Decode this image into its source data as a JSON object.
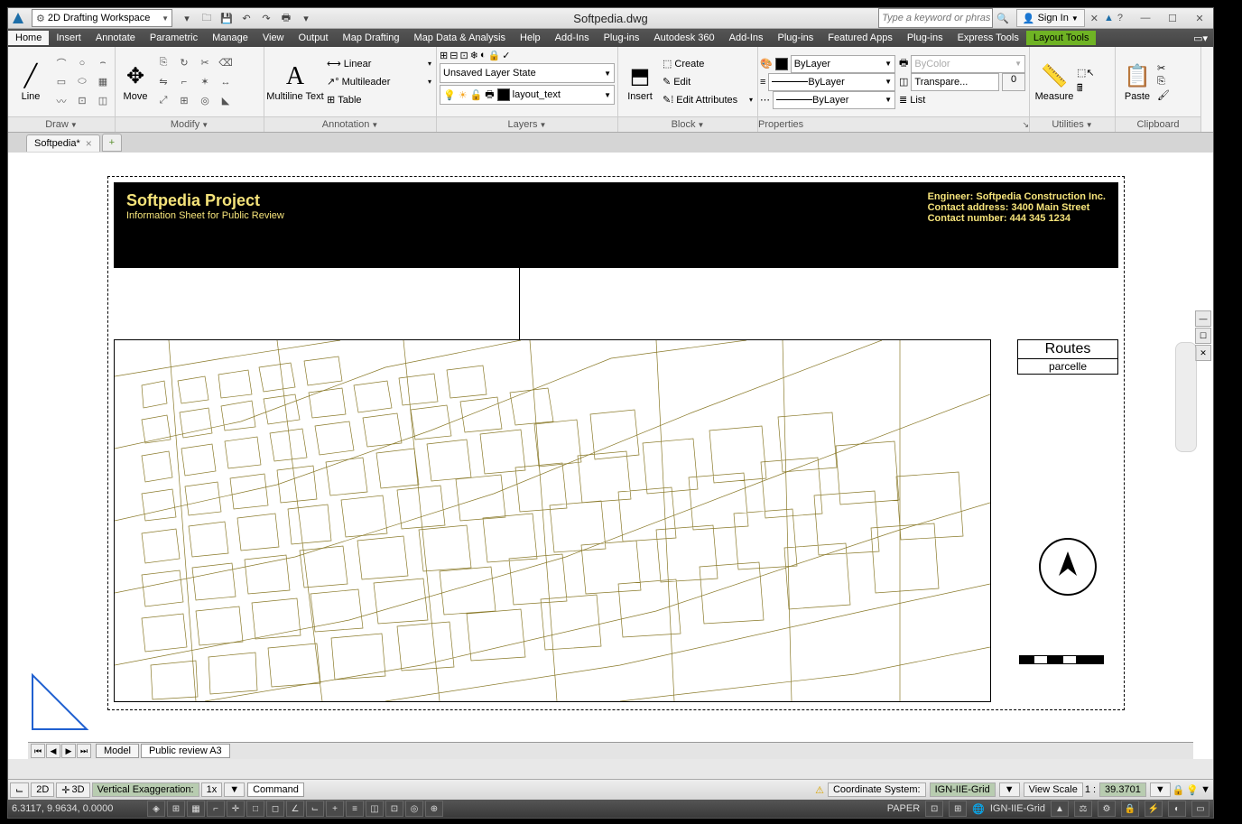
{
  "title": "Softpedia.dwg",
  "workspace": "2D Drafting Workspace",
  "search_placeholder": "Type a keyword or phrase",
  "signin": "Sign In",
  "menubar": [
    "Home",
    "Insert",
    "Annotate",
    "Parametric",
    "Manage",
    "View",
    "Output",
    "Map Drafting",
    "Map Data & Analysis",
    "Help",
    "Add-Ins",
    "Plug-ins",
    "Autodesk 360",
    "Add-Ins",
    "Plug-ins",
    "Featured Apps",
    "Plug-ins",
    "Express Tools",
    "Layout Tools"
  ],
  "ribbon": {
    "draw": {
      "line": "Line",
      "title": "Draw"
    },
    "modify": {
      "move": "Move",
      "title": "Modify"
    },
    "annotation": {
      "mtext": "Multiline Text",
      "linear": "Linear",
      "multileader": "Multileader",
      "table": "Table",
      "title": "Annotation"
    },
    "layers": {
      "state": "Unsaved Layer State",
      "current": "layout_text",
      "title": "Layers"
    },
    "block": {
      "insert": "Insert",
      "create": "Create",
      "edit": "Edit",
      "editattr": "Edit Attributes",
      "title": "Block"
    },
    "properties": {
      "bylayer": "ByLayer",
      "bylayer2": "ByLayer",
      "bylayer3": "ByLayer",
      "bycolor": "ByColor",
      "transp": "Transpare...",
      "transp_val": "0",
      "list": "List",
      "title": "Properties"
    },
    "utilities": {
      "measure": "Measure",
      "title": "Utilities"
    },
    "clipboard": {
      "paste": "Paste",
      "title": "Clipboard"
    }
  },
  "doctab": "Softpedia*",
  "sheet": {
    "title": "Softpedia Project",
    "subtitle": "Information Sheet for Public Review",
    "engineer": "Engineer: Softpedia Construction Inc.",
    "address": "Contact address: 3400 Main Street",
    "phone": "Contact number: 444 345 1234"
  },
  "legend": {
    "head": "Routes",
    "row": "parcelle"
  },
  "layout_tabs": {
    "model": "Model",
    "layout": "Public review A3"
  },
  "statusbar1": {
    "b2d": "2D",
    "b3d": "3D",
    "ve": "Vertical Exaggeration:",
    "ve_val": "1x",
    "cmd": "Command",
    "cs_label": "Coordinate System:",
    "cs_val": "IGN-IIE-Grid",
    "vs_label": "View Scale",
    "vs_pre": "1 :",
    "vs_val": "39.3701"
  },
  "statusbar2": {
    "coords": "6.3117, 9.9634, 0.0000",
    "paper": "PAPER",
    "grid": "IGN-IIE-Grid"
  }
}
